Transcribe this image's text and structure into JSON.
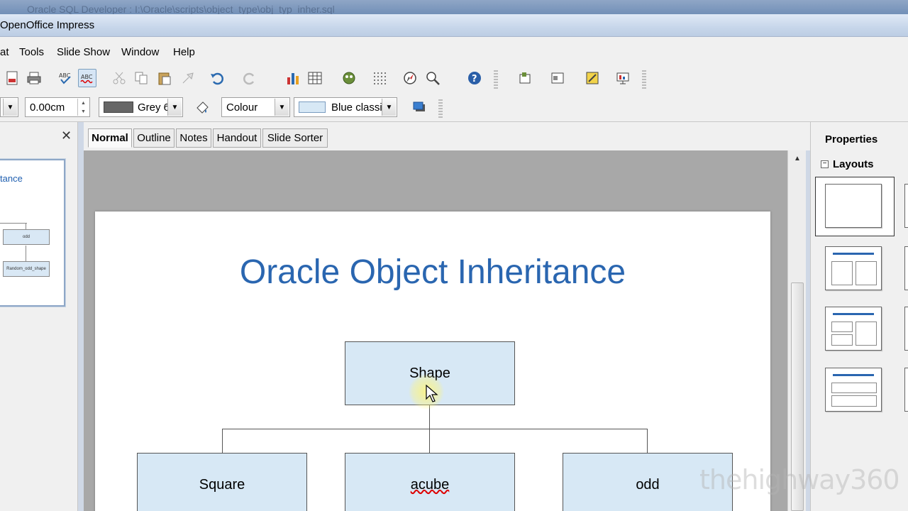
{
  "bg_window": {
    "title": "Oracle SQL Developer : I:\\Oracle\\scripts\\object_type\\obj_typ_inher.sql"
  },
  "window": {
    "title": "OpenOffice Impress"
  },
  "menu": [
    "at",
    "Tools",
    "Slide Show",
    "Window",
    "Help"
  ],
  "toolbar1": {
    "icons": [
      "export-pdf-icon",
      "print-icon",
      "spellcheck-icon",
      "autospellcheck-icon",
      "cut-icon",
      "copy-icon",
      "paste-icon",
      "clone-format-icon",
      "undo-icon",
      "redo-icon",
      "chart-icon",
      "table-icon",
      "gallery-icon",
      "grid-icon",
      "navigator-icon",
      "zoom-icon",
      "help-icon",
      "slide-icon",
      "slide-layout-icon",
      "slide-design-icon",
      "display-icon"
    ]
  },
  "toolbar2": {
    "line_width": "0.00cm",
    "line_color": "Grey 6",
    "area_style": "Colour",
    "area_fill": "Blue classic"
  },
  "view_tabs": [
    "Normal",
    "Outline",
    "Notes",
    "Handout",
    "Slide Sorter"
  ],
  "active_tab": "Normal",
  "slide_pane": {
    "thumb_title": "tance",
    "thumb_boxes": [
      "odd",
      "Random_odd_shape"
    ]
  },
  "slide": {
    "title": "Oracle Object Inheritance",
    "nodes": {
      "root": "Shape",
      "children": [
        "Square",
        "acube",
        "odd"
      ]
    },
    "colors": {
      "title": "#2a66b0",
      "node_fill": "#d7e8f5"
    }
  },
  "properties": {
    "title": "Properties",
    "layouts_label": "Layouts",
    "collapse_symbol": "−"
  },
  "watermark": "thehighway360"
}
